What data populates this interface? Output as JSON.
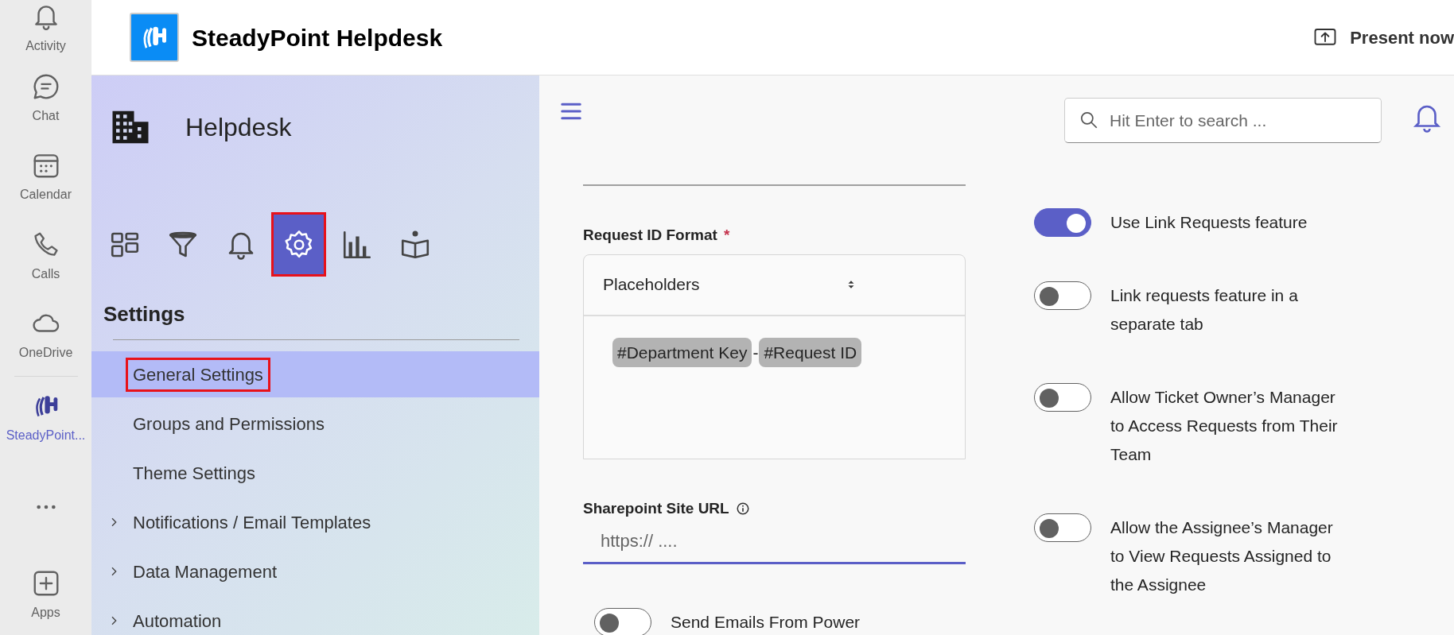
{
  "rail": {
    "items": [
      {
        "label": "Activity",
        "selected": false
      },
      {
        "label": "Chat",
        "selected": false
      },
      {
        "label": "Calendar",
        "selected": false
      },
      {
        "label": "Calls",
        "selected": false
      },
      {
        "label": "OneDrive",
        "selected": false
      },
      {
        "label": "SteadyPoint...",
        "selected": true
      },
      {
        "label": "Apps",
        "selected": false
      }
    ]
  },
  "header": {
    "title": "SteadyPoint Helpdesk",
    "present_button": "Present now"
  },
  "sidebar": {
    "title": "Helpdesk",
    "nav_icons": [
      {
        "selected": false,
        "annotated": false
      },
      {
        "selected": false,
        "annotated": false
      },
      {
        "selected": false,
        "annotated": false
      },
      {
        "selected": true,
        "annotated": true
      },
      {
        "selected": false,
        "annotated": false
      },
      {
        "selected": false,
        "annotated": false
      }
    ],
    "section_title": "Settings",
    "items": [
      {
        "label": "General Settings",
        "kind": "link",
        "selected": true,
        "annotated": true
      },
      {
        "label": "Groups and Permissions",
        "kind": "link",
        "selected": false,
        "annotated": false
      },
      {
        "label": "Theme Settings",
        "kind": "link",
        "selected": false,
        "annotated": false
      },
      {
        "label": "Notifications / Email Templates",
        "kind": "group",
        "selected": false,
        "annotated": false
      },
      {
        "label": "Data Management",
        "kind": "group",
        "selected": false,
        "annotated": false
      },
      {
        "label": "Automation",
        "kind": "group",
        "selected": false,
        "annotated": false
      }
    ]
  },
  "search": {
    "placeholder": "Hit Enter to search ..."
  },
  "request_id_format": {
    "label": "Request ID Format",
    "required_mark": "*",
    "select_value": "Placeholders",
    "tokens": [
      "#Department Key",
      "#Request ID"
    ],
    "separator": "-"
  },
  "sharepoint_url": {
    "label": "Sharepoint Site URL",
    "placeholder": "https:// ...."
  },
  "left_toggles": [
    {
      "label": "Send Emails From Power",
      "on": false
    }
  ],
  "right_toggles": [
    {
      "label": "Use Link Requests feature",
      "on": true
    },
    {
      "label": "Link requests feature in a separate tab",
      "on": false
    },
    {
      "label": "Allow Ticket Owner’s Manager to Access Requests from Their Team",
      "on": false
    },
    {
      "label": "Allow the Assignee’s Manager to View Requests Assigned to the Assignee",
      "on": false
    }
  ]
}
